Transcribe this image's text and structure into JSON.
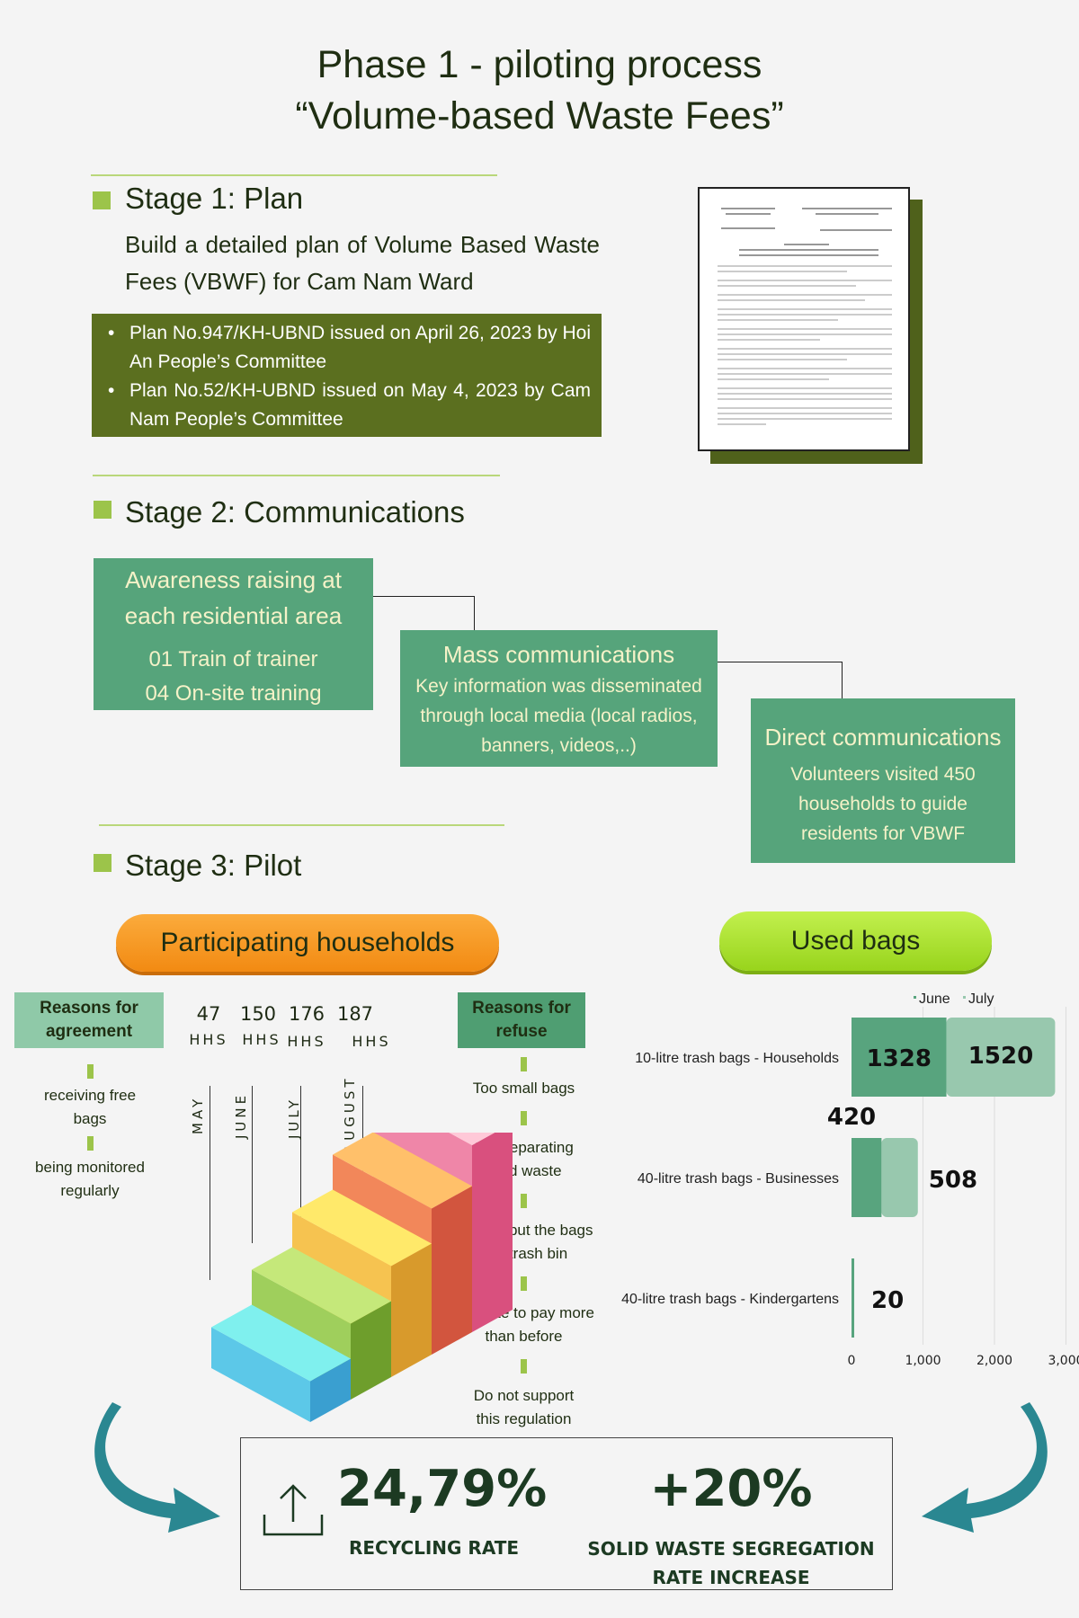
{
  "title": {
    "line1": "Phase 1 - piloting process",
    "line2": "“Volume-based Waste Fees”"
  },
  "stage1": {
    "heading": "Stage 1: Plan",
    "description": "Build a detailed plan of Volume Based Waste Fees (VBWF) for Cam Nam Ward",
    "bullets": [
      "Plan No.947/KH-UBND issued on April 26, 2023 by Hoi An People’s Committee",
      "Plan No.52/KH-UBND issued on May 4, 2023 by Cam Nam People’s Committee"
    ]
  },
  "stage2": {
    "heading": "Stage 2: Communications",
    "awareness": {
      "title": "Awareness raising at each residential area",
      "items": [
        "01 Train of trainer",
        "04 On-site training"
      ]
    },
    "mass": {
      "title": "Mass communications",
      "body": "Key information was disseminated through local media (local radios, banners, videos,..)"
    },
    "direct": {
      "title": "Direct communications",
      "body": "Volunteers visited 450 households to guide residents for VBWF"
    }
  },
  "stage3": {
    "heading": "Stage 3: Pilot",
    "households_label": "Participating households",
    "bags_label": "Used bags",
    "agreement": {
      "title": "Reasons for agreement",
      "items": [
        "receiving free bags",
        "being monitored regularly"
      ]
    },
    "refuse": {
      "title": "Reasons for refuse",
      "items": [
        "Too small bags",
        "Not separating solid waste",
        "Hard to put the bags into trash bin",
        "Hesitate to pay more than before",
        "Do not support this regulation"
      ]
    },
    "months": [
      {
        "month": "MAY",
        "count": "47",
        "unit": "HHS"
      },
      {
        "month": "JUNE",
        "count": "150",
        "unit": "HHS"
      },
      {
        "month": "JULY",
        "count": "176",
        "unit": "HHS"
      },
      {
        "month": "AUGUST",
        "count": "187",
        "unit": "HHS"
      }
    ]
  },
  "chart_data": {
    "type": "bar",
    "orientation": "horizontal",
    "stacked": true,
    "categories": [
      "10-litre trash bags - Households",
      "40-litre trash bags - Businesses",
      "40-litre trash bags - Kindergartens"
    ],
    "series": [
      {
        "name": "June",
        "values": [
          1328,
          420,
          20
        ],
        "color": "#58a47e"
      },
      {
        "name": "July",
        "values": [
          1520,
          508,
          null
        ],
        "color": "#98c8ae"
      }
    ],
    "data_labels": [
      [
        "1328",
        "1520"
      ],
      [
        "420",
        "508"
      ],
      [
        "20"
      ]
    ],
    "xticks": [
      "0",
      "1,000",
      "2,000",
      "3,000"
    ],
    "xlim": [
      0,
      3000
    ],
    "grid": true,
    "legend": "top-right"
  },
  "results": {
    "recycling_value": "24,79%",
    "recycling_label": "RECYCLING RATE",
    "segregation_value": "+20%",
    "segregation_label_1": "SOLID WASTE SEGREGATION",
    "segregation_label_2": "RATE INCREASE"
  },
  "colors": {
    "olive": "#5b6f1f",
    "green": "#56a47b",
    "orange": "#f7931e",
    "lime": "#a6e22e",
    "teal": "#2a8a95"
  }
}
